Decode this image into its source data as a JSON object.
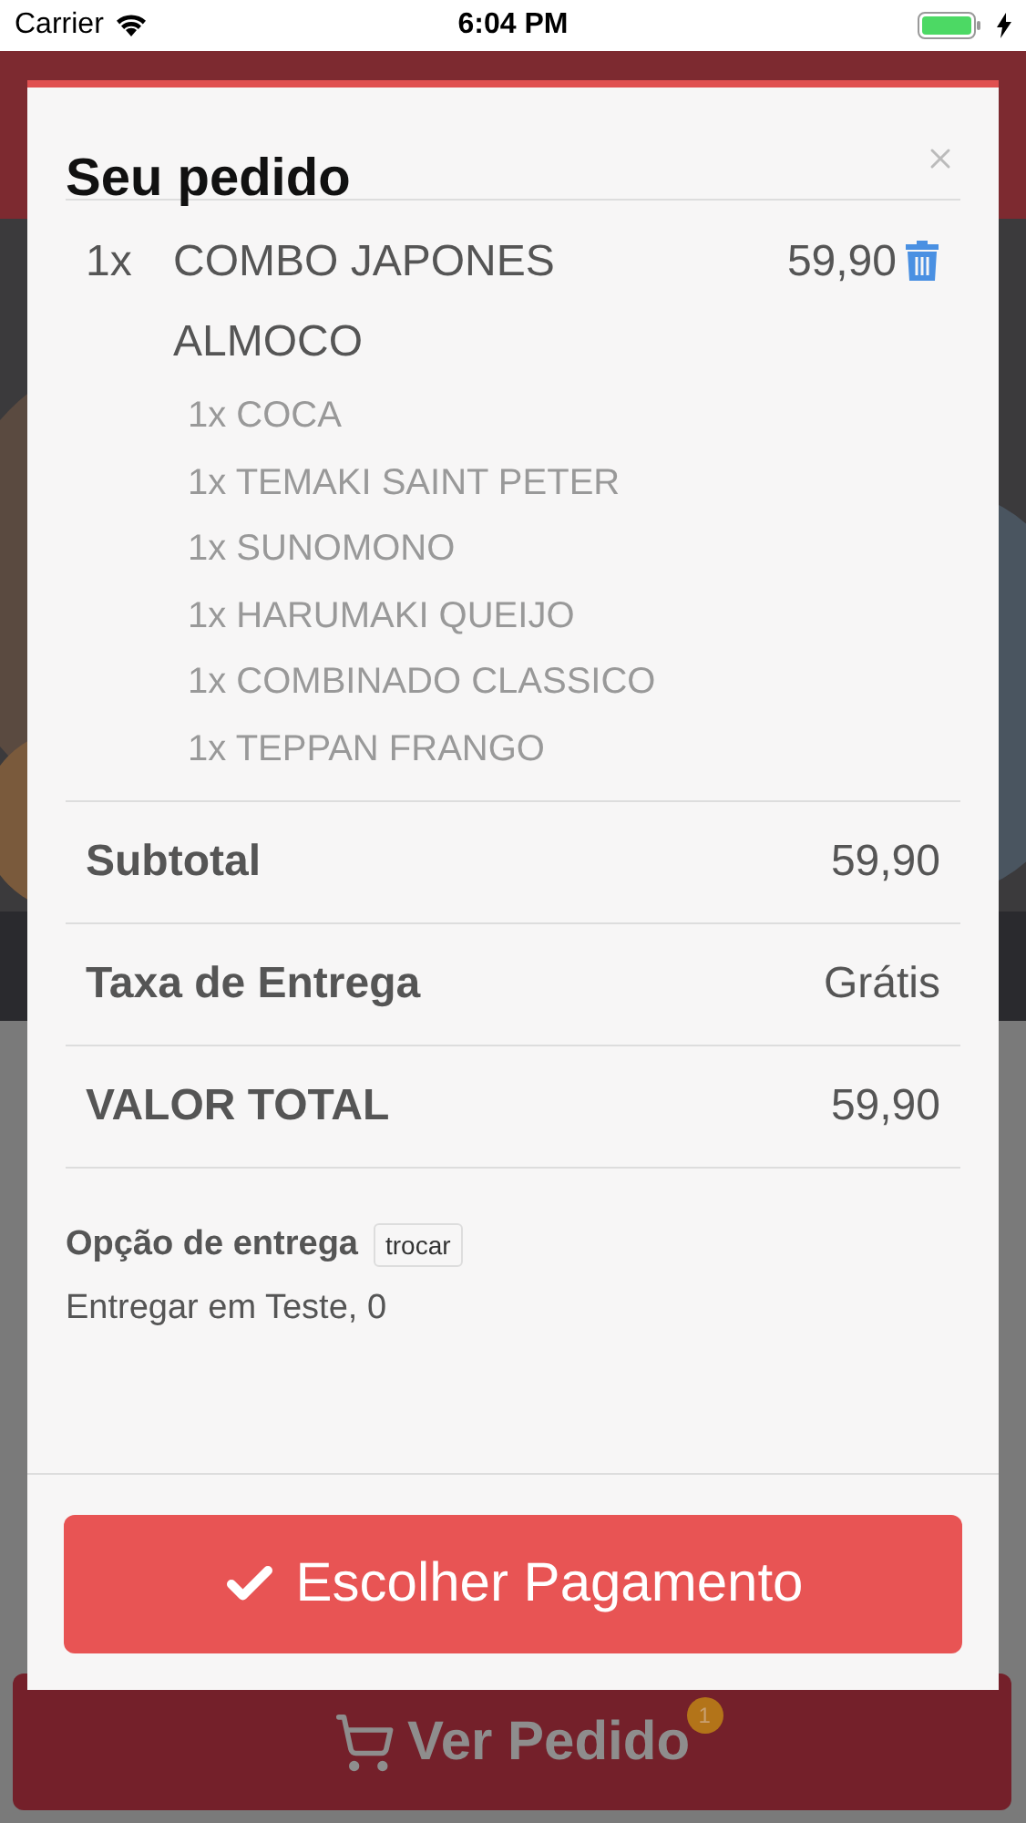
{
  "status_bar": {
    "carrier": "Carrier",
    "time": "6:04 PM"
  },
  "modal": {
    "title": "Seu pedido",
    "items": [
      {
        "quantity": "1x",
        "name": "COMBO JAPONES ALMOCO",
        "price": "59,90",
        "options": [
          "1x COCA",
          "1x TEMAKI SAINT PETER",
          "1x SUNOMONO",
          "1x HARUMAKI QUEIJO",
          "1x COMBINADO CLASSICO",
          "1x TEPPAN FRANGO"
        ]
      }
    ],
    "summary": [
      {
        "label": "Subtotal",
        "value": "59,90"
      },
      {
        "label": "Taxa de Entrega",
        "value": "Grátis"
      },
      {
        "label": "VALOR TOTAL",
        "value": "59,90"
      }
    ],
    "delivery": {
      "label": "Opção de entrega",
      "change_button": "trocar",
      "address": "Entregar em Teste, 0"
    },
    "pay_button": "Escolher Pagamento"
  },
  "order_bar": {
    "label": "Ver Pedido",
    "badge": "1"
  }
}
